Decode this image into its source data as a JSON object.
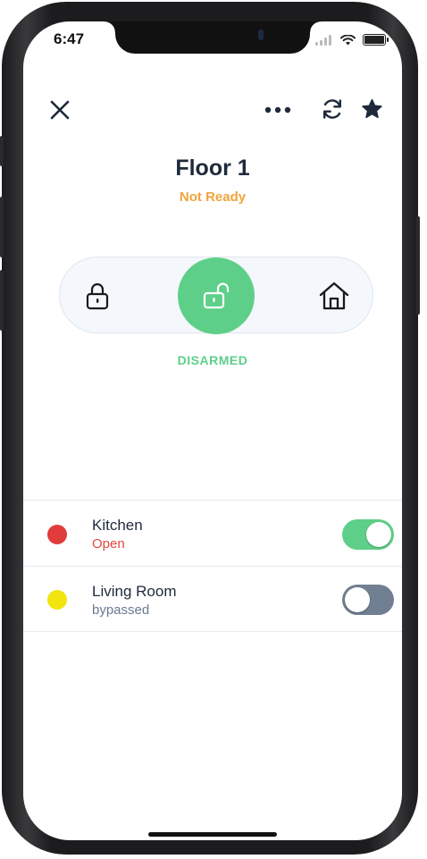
{
  "status_bar": {
    "time": "6:47"
  },
  "header": {
    "close_icon": "close-icon",
    "more_icon": "more-horizontal-icon",
    "refresh_icon": "refresh-icon",
    "favorite_icon": "star-icon"
  },
  "partition": {
    "title": "Floor 1",
    "subtitle": "Not Ready",
    "subtitle_color": "#f0a43c"
  },
  "arm_modes": {
    "options": [
      {
        "name": "armed-away",
        "icon": "lock-closed-icon",
        "active": false
      },
      {
        "name": "disarmed",
        "icon": "lock-open-icon",
        "active": true
      },
      {
        "name": "armed-home",
        "icon": "home-icon",
        "active": false
      }
    ],
    "current_label": "DISARMED",
    "active_color": "#5ecf89"
  },
  "zones": [
    {
      "name": "Kitchen",
      "status": "Open",
      "status_color": "#e0463f",
      "dot_color": "#e13c3c",
      "bypass_toggle": true
    },
    {
      "name": "Living Room",
      "status": "bypassed",
      "status_color": "#6b7a90",
      "dot_color": "#f2e40f",
      "bypass_toggle": false
    }
  ]
}
